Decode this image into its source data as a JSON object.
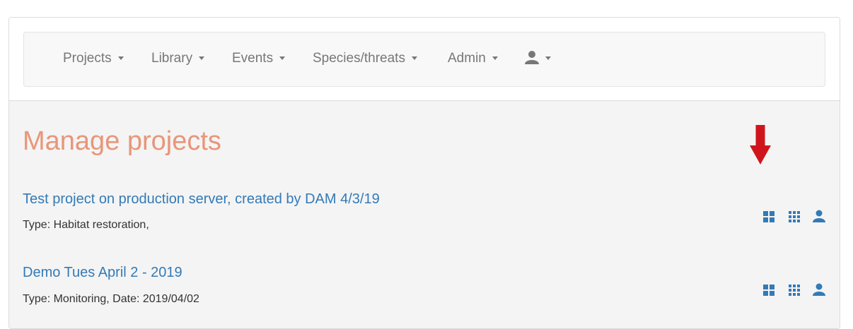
{
  "nav": {
    "items": [
      {
        "label": "Projects"
      },
      {
        "label": "Library"
      },
      {
        "label": "Events"
      },
      {
        "label": "Species/threats"
      },
      {
        "label": "Admin"
      }
    ],
    "user_icon": "user-icon"
  },
  "page": {
    "title": "Manage projects"
  },
  "projects": [
    {
      "name": "Test project on production server, created by DAM 4/3/19",
      "meta": "Type: Habitat restoration,"
    },
    {
      "name": "Demo Tues April 2 - 2019",
      "meta": "Type: Monitoring, Date: 2019/04/02"
    }
  ],
  "row_icons": [
    "dashboard-icon",
    "grid-icon",
    "user-icon"
  ],
  "colors": {
    "accent": "#e8967a",
    "link": "#337ab7",
    "annotation": "#d0141b"
  }
}
